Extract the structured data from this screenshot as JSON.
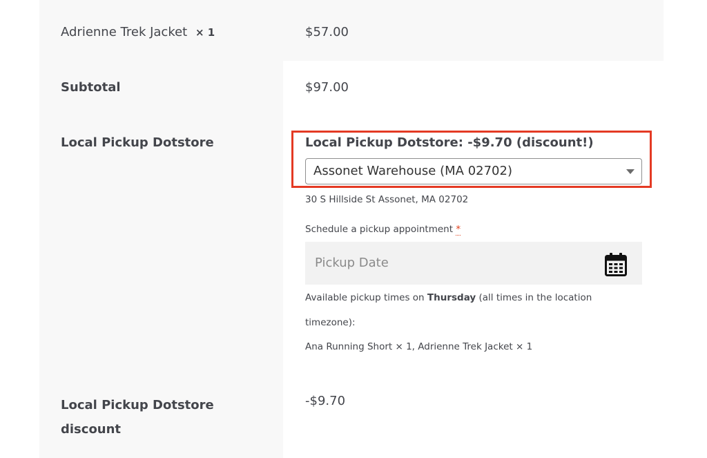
{
  "order_item": {
    "name": "Adrienne Trek Jacket",
    "quantity": "× 1",
    "price": "$57.00"
  },
  "subtotal": {
    "label": "Subtotal",
    "value": "$97.00"
  },
  "shipping": {
    "label": "Local Pickup Dotstore",
    "method_label": "Local Pickup Dotstore: -$9.70 (discount!)",
    "location_select": {
      "selected": "Assonet Warehouse (MA 02702)"
    },
    "address": "30 S Hillside St Assonet, MA 02702",
    "schedule_label": "Schedule a pickup appointment",
    "required_marker": "*",
    "date_input": {
      "placeholder": "Pickup Date",
      "icon": "calendar-icon"
    },
    "availability": {
      "prefix": "Available pickup times on ",
      "day": "Thursday",
      "suffix": " (all times in the location",
      "line2": "timezone):"
    },
    "package_items": "Ana Running Short × 1, Adrienne Trek Jacket × 1"
  },
  "discount": {
    "label_line1": "Local Pickup Dotstore",
    "label_line2": "discount",
    "value": "-$9.70"
  },
  "colors": {
    "highlight_border": "#e43a24",
    "required_star": "#e2401c",
    "panel_bg": "#f8f8f8"
  }
}
